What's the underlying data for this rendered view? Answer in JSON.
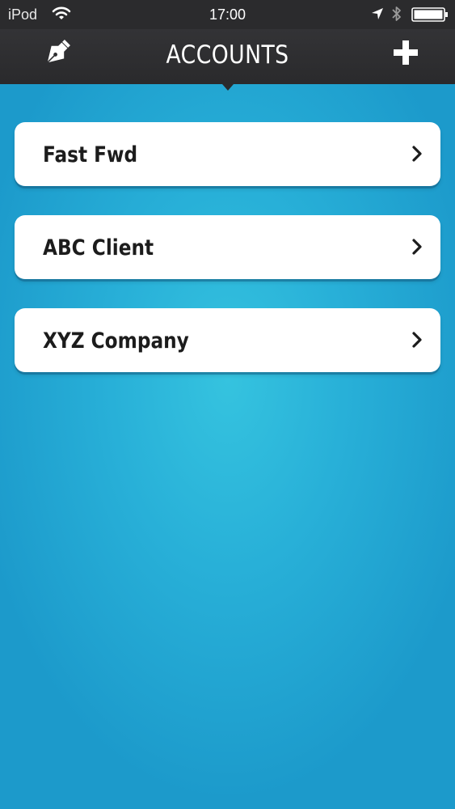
{
  "status_bar": {
    "carrier": "iPod",
    "time": "17:00",
    "icons": [
      "wifi-icon",
      "location-icon",
      "bluetooth-icon",
      "battery-icon"
    ]
  },
  "nav_bar": {
    "title": "ACCOUNTS",
    "left_icon": "pen-nib-icon",
    "right_icon": "plus-icon"
  },
  "accounts": [
    {
      "label": "Fast Fwd",
      "icon": "chevron-right-icon"
    },
    {
      "label": "ABC Client",
      "icon": "chevron-right-icon"
    },
    {
      "label": "XYZ Company",
      "icon": "chevron-right-icon"
    }
  ],
  "colors": {
    "nav_background": "#2b2b2d",
    "background_light": "#35c3df",
    "background_dark": "#1c9acb",
    "row_background": "#ffffff",
    "text": "#1c1c1c"
  }
}
